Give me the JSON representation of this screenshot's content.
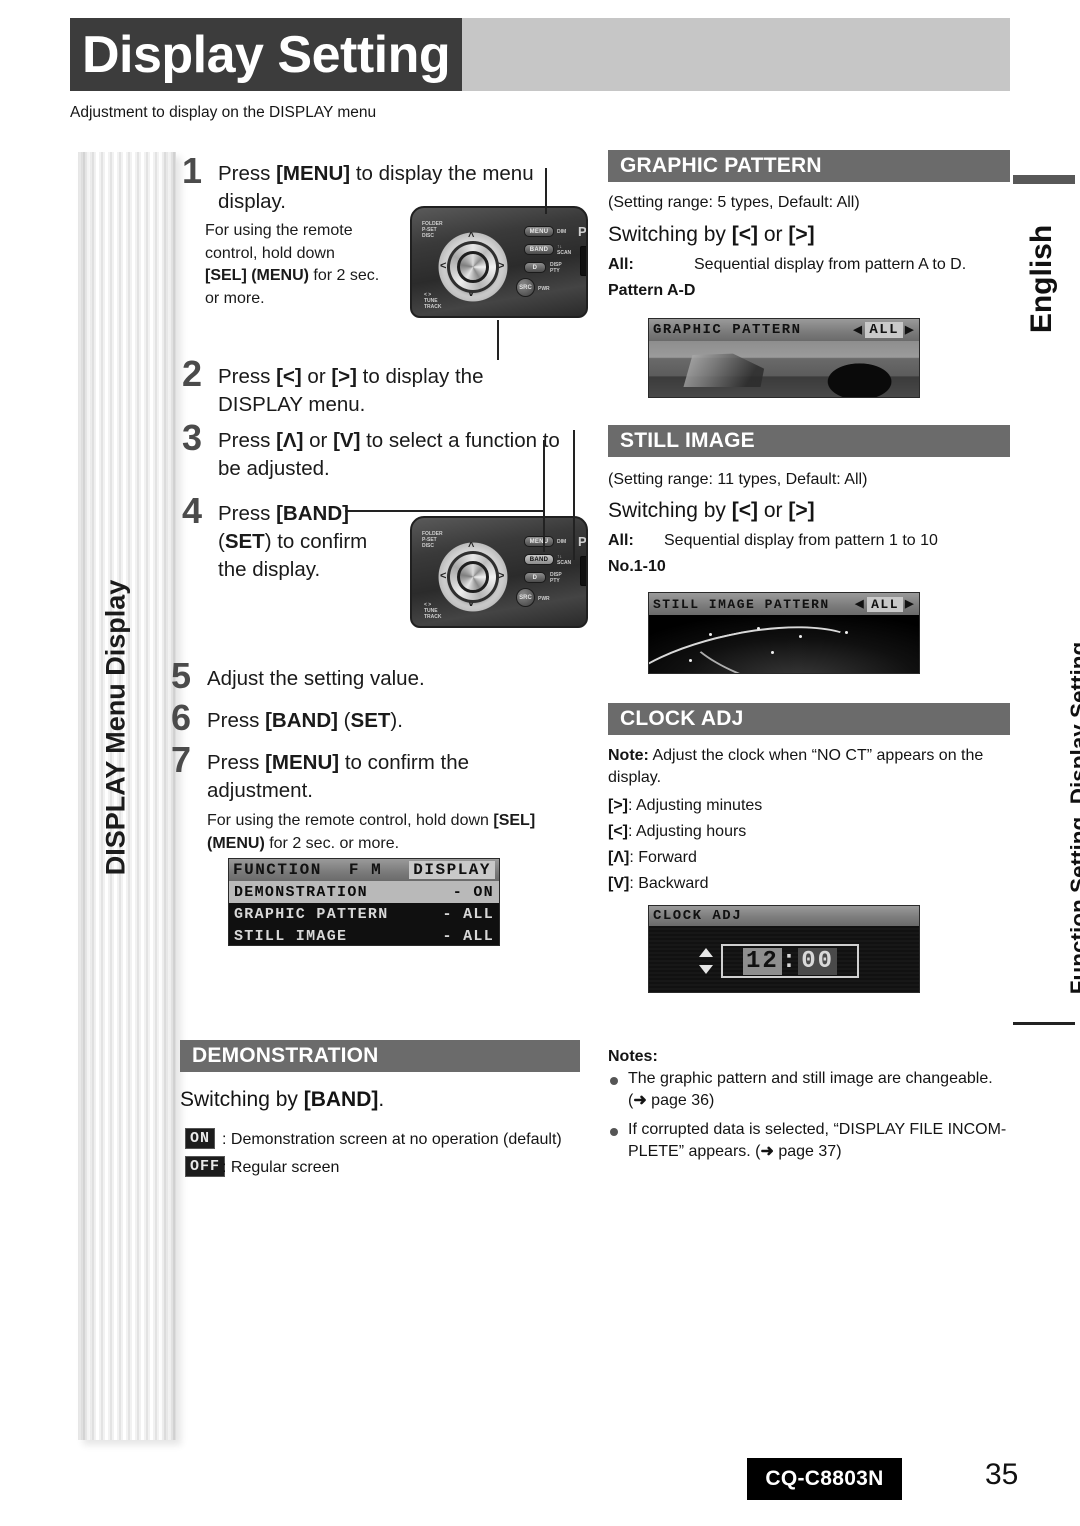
{
  "header": {
    "title": "Display Setting",
    "subtitle": "Adjustment to display on the DISPLAY menu"
  },
  "sidebar_left": {
    "label": "DISPLAY Menu Display"
  },
  "sidebar_right": {
    "language": "English",
    "chapter": "Function Setting, Display Setting"
  },
  "steps": [
    {
      "num": "1",
      "text_html": "Press <b>[MENU]</b> to display the menu display.",
      "sub_html": "For using the remote control, hold down <b>[SEL] (MENU)</b> for 2 sec. or more."
    },
    {
      "num": "2",
      "text_html": "Press <b>[&lt;]</b> or <b>[&gt;]</b> to display the DISPLAY menu."
    },
    {
      "num": "3",
      "text_html": "Press <b>[&#923;]</b> or <b>[V]</b> to select a function to be adjusted."
    },
    {
      "num": "4",
      "text_html": "Press <b>[BAND]</b> (<b>SET</b>) to confirm the display."
    },
    {
      "num": "5",
      "text_html": "Adjust the setting value."
    },
    {
      "num": "6",
      "text_html": "Press <b>[BAND]</b> (<b>SET</b>)."
    },
    {
      "num": "7",
      "text_html": "Press <b>[MENU]</b> to confirm the adjustment.",
      "sub_html": "For using the remote control, hold down <b>[SEL] (MENU)</b> for 2 sec. or more."
    }
  ],
  "menu_lcd": {
    "title_left": "FUNCTION",
    "title_mid": "F M",
    "title_right": "DISPLAY",
    "rows": [
      {
        "marker": "■",
        "label": "DEMONSTRATION",
        "value": "- ON",
        "selected": true
      },
      {
        "marker": "■",
        "label": "GRAPHIC PATTERN",
        "value": "- ALL",
        "selected": false
      },
      {
        "marker": "▼",
        "label": "STILL IMAGE",
        "value": "- ALL",
        "selected": false
      }
    ]
  },
  "demonstration": {
    "heading": "DEMONSTRATION",
    "switching_html": "Switching by <b>[BAND]</b>.",
    "options": [
      {
        "glyph": "ON",
        "desc": ": Demonstration screen at no operation (default)"
      },
      {
        "glyph": "OFF",
        "desc": ": Regular screen"
      }
    ]
  },
  "graphic_pattern": {
    "heading": "GRAPHIC PATTERN",
    "range": "(Setting range: 5 types, Default: All)",
    "switching_html": "Switching by <b>[&lt;]</b> or <b>[&gt;]</b>",
    "all_label": "All:",
    "all_desc": "Sequential display from pattern A to D.",
    "pattern_label": "Pattern A-D",
    "lcd": {
      "title": "GRAPHIC PATTERN",
      "value": "ALL",
      "left_arrow": "◀",
      "right_arrow": "▶"
    }
  },
  "still_image": {
    "heading": "STILL IMAGE",
    "range": "(Setting range: 11 types, Default: All)",
    "switching_html": "Switching by <b>[&lt;]</b> or <b>[&gt;]</b>",
    "all_label": "All:",
    "all_desc": "Sequential display from pattern 1 to 10",
    "pattern_label": "No.1-10",
    "lcd": {
      "title": "STILL IMAGE PATTERN",
      "value": "ALL",
      "left_arrow": "◀",
      "right_arrow": "▶"
    }
  },
  "clock_adj": {
    "heading": "CLOCK ADJ",
    "note_html": "<b>Note:</b> Adjust the clock when “NO CT” appears on the display.",
    "keys": [
      {
        "key_html": "<b>[&gt;]</b>",
        "desc": ": Adjusting minutes"
      },
      {
        "key_html": "<b>[&lt;]</b>",
        "desc": ": Adjusting hours"
      },
      {
        "key_html": "<b>[&#923;]</b>",
        "desc": ": Forward"
      },
      {
        "key_html": "<b>[V]</b>",
        "desc": ": Backward"
      }
    ],
    "lcd": {
      "title": "CLOCK ADJ",
      "hours": "12",
      "colon": ":",
      "minutes": "00"
    }
  },
  "notes": {
    "heading": "Notes:",
    "items_html": [
      "The graphic pattern and still image are changeable. (<b>➜</b> page 36)",
      "If corrupted data is selected, “DISPLAY FILE INCOM-PLETE” appears. (<b>➜</b> page 37)"
    ]
  },
  "radio_unit": {
    "menu_button": "MENU",
    "band_button": "BAND",
    "disp_button": "DISP",
    "src_button": "SRC",
    "pwr_label": "PWR",
    "dim_label": "DIM",
    "scan_label": "SCAN",
    "pty_label": "PTY",
    "brand": "Pa",
    "left_labels": "FOLDER\nP-SET\nDISC",
    "bottom_labels": "TUNE\nTRACK"
  },
  "footer": {
    "model": "CQ-C8803N",
    "page": "35"
  }
}
